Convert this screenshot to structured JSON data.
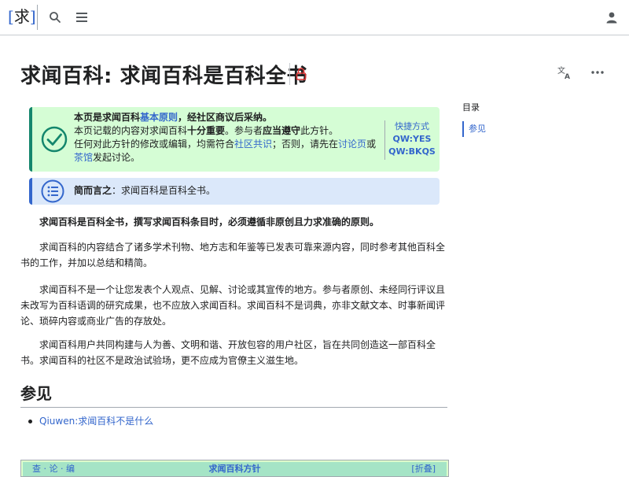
{
  "header": {
    "logo_text": "求",
    "search_icon": "search-icon",
    "menu_icon": "hamburger-menu-icon",
    "user_icon": "user-icon"
  },
  "page": {
    "title": "求闻百科: 求闻百科是百科全书",
    "translate_label": "文A",
    "more_icon": "more-dots-icon"
  },
  "notice": {
    "line1_a": "本页是求闻百科",
    "line1_link": "基本原则",
    "line1_b": "，经社区商议后采纳。",
    "line2_a": "本页记载的内容对求闻百科",
    "line2_bold1": "十分重要",
    "line2_b": "。参与者",
    "line2_bold2": "应当遵守",
    "line2_c": "此方针。",
    "line3_a": "任何对此方针的修改或编辑，均需符合",
    "line3_link1": "社区共识",
    "line3_b": "；否则，请先在",
    "line3_link2": "讨论页",
    "line3_c": "或",
    "line3_link3": "茶馆",
    "line3_d": "发起讨论。",
    "shortcut_title": "快捷方式",
    "shortcut_1": "QW:YES",
    "shortcut_2": "QW:BKQS"
  },
  "summary": {
    "label": "简而言之",
    "text": "：求闻百科是百科全书。"
  },
  "body": {
    "p1": "求闻百科是百科全书，撰写求闻百科条目时，必须遵循非原创且力求准确的原则。",
    "p2": "求闻百科的内容结合了诸多学术刊物、地方志和年鉴等已发表可靠来源内容，同时参考其他百科全书的工作，并加以总结和精简。",
    "p3": "求闻百科不是一个让您发表个人观点、见解、讨论或其宣传的地方。参与者原创、未经同行评议且未改写为百科语调的研究成果，也不应放入求闻百科。求闻百科不是词典，亦非文献文本、时事新闻评论、琐碎内容或商业广告的存放处。",
    "p4": "求闻百科用户共同构建与人为善、文明和谐、开放包容的用户社区，旨在共同创造这一部百科全书。求闻百科的社区不是政治试验场，更不应成为官僚主义滋生地。"
  },
  "see_also": {
    "heading": "参见",
    "items": [
      "Qiuwen:求闻百科不是什么"
    ]
  },
  "navbox": {
    "vte": "查 · 论 · 编",
    "title": "求闻百科方针",
    "fold": "[折叠]"
  },
  "toc": {
    "title": "目录",
    "items": [
      "参见"
    ]
  },
  "colors": {
    "link": "#3366cc",
    "notice_green": "#d5fdd5",
    "notice_border": "#14866d",
    "summary_blue": "#dbe8fa",
    "lock_red": "#d33"
  }
}
